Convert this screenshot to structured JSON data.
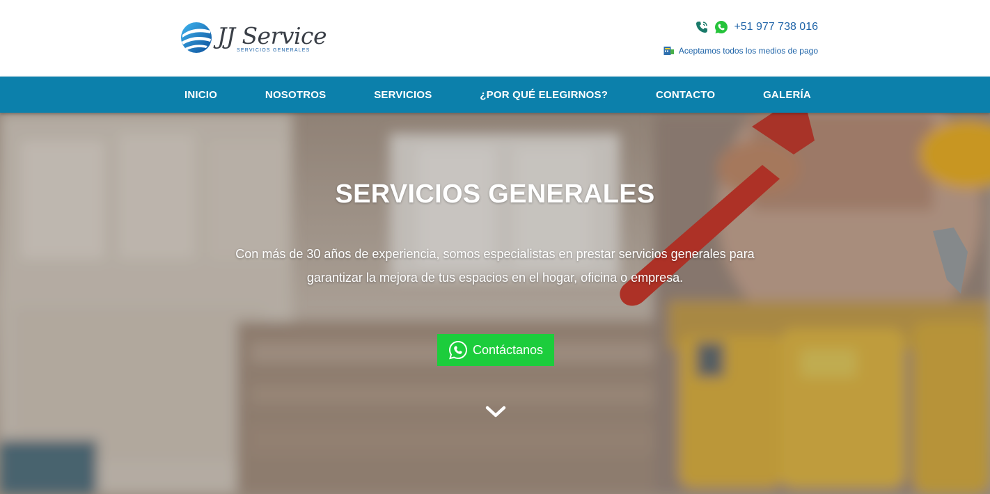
{
  "header": {
    "logo": {
      "title": "JJ Service",
      "subtitle": "SERVICIOS GENERALES"
    },
    "phone": {
      "number": "+51 977 738 016",
      "icons": [
        "phone-icon",
        "whatsapp-icon"
      ]
    },
    "payment": {
      "text": "Aceptamos todos los medios de pago",
      "icon": "payment-card-icon"
    }
  },
  "nav": {
    "items": [
      {
        "label": "INICIO"
      },
      {
        "label": "NOSOTROS"
      },
      {
        "label": "SERVICIOS"
      },
      {
        "label": "¿POR QUÉ ELEGIRNOS?"
      },
      {
        "label": "CONTACTO"
      },
      {
        "label": "GALERÍA"
      }
    ]
  },
  "hero": {
    "title": "SERVICIOS GENERALES",
    "description": "Con más de 30 años de experiencia, somos especialistas en prestar servicios generales para garantizar la mejora de tus espacios en el hogar, oficina o empresa.",
    "cta_label": "Contáctanos",
    "cta_icon": "whatsapp-icon",
    "scroll_icon": "chevron-down-icon"
  },
  "colors": {
    "brand_blue": "#1f64a8",
    "nav_bg": "#0c80ab",
    "cta_green": "#1ccd3c",
    "text_white": "#ffffff"
  }
}
